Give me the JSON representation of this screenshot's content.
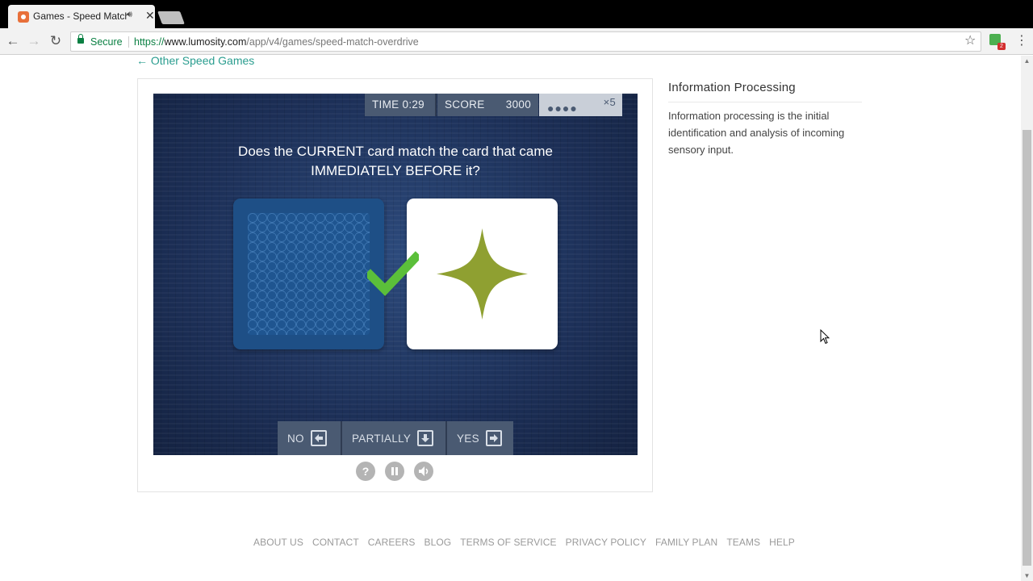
{
  "browser": {
    "tab_title": "Games - Speed Match",
    "tab_audio_icon": "speaker-icon",
    "tab_close": "✕",
    "secure_label": "Secure",
    "url_scheme": "https://",
    "url_host": "www.lumosity.com",
    "url_path": "/app/v4/games/speed-match-overdrive",
    "extension_badge": "2"
  },
  "page": {
    "back_link": "← Other Speed Games"
  },
  "game": {
    "time_label": "TIME",
    "time_value": "0:29",
    "score_label": "SCORE",
    "score_value": "3000",
    "streak_dots": "●●●●",
    "multiplier": "×5",
    "question": "Does the CURRENT card match the card that came IMMEDIATELY BEFORE it?",
    "current_card_symbol": "four-point-star",
    "symbol_color": "#8fa031",
    "feedback": "correct",
    "answers": {
      "no": "NO",
      "partially": "PARTIALLY",
      "yes": "YES"
    },
    "controls": {
      "help": "?",
      "pause": "pause",
      "sound": "sound"
    }
  },
  "sidebar": {
    "title": "Information Processing",
    "body": "Information processing is the initial identification and analysis of incoming sensory input."
  },
  "footer": {
    "links": [
      "ABOUT US",
      "CONTACT",
      "CAREERS",
      "BLOG",
      "TERMS OF SERVICE",
      "PRIVACY POLICY",
      "FAMILY PLAN",
      "TEAMS",
      "HELP"
    ]
  },
  "colors": {
    "link_teal": "#2a9d8f",
    "check_green": "#5bbf3a",
    "hud_slate": "#4a5a72",
    "stage_navy": "#1c2f57"
  }
}
